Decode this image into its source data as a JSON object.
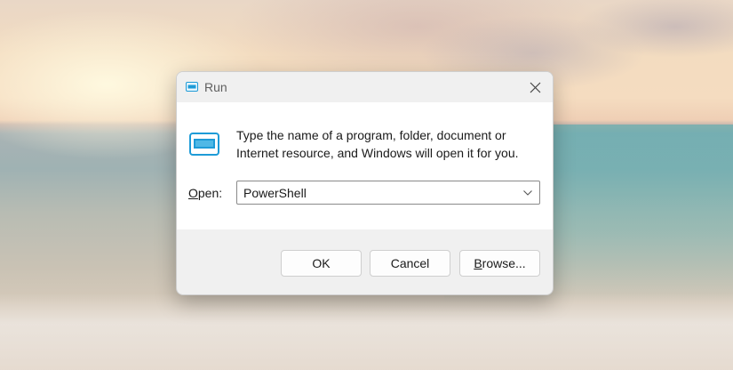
{
  "dialog": {
    "title": "Run",
    "icon": "run-icon",
    "close_icon": "close-icon",
    "description": "Type the name of a program, folder, document or Internet resource, and Windows will open it for you.",
    "open_label_accel": "O",
    "open_label_rest": "pen:",
    "input_value": "PowerShell",
    "dropdown_icon": "chevron-down-icon",
    "buttons": {
      "ok": "OK",
      "cancel": "Cancel",
      "browse_accel": "B",
      "browse_rest": "rowse..."
    }
  },
  "colors": {
    "dialog_bg": "#f0f0f0",
    "content_bg": "#ffffff",
    "icon_accent": "#1e9bd7"
  }
}
